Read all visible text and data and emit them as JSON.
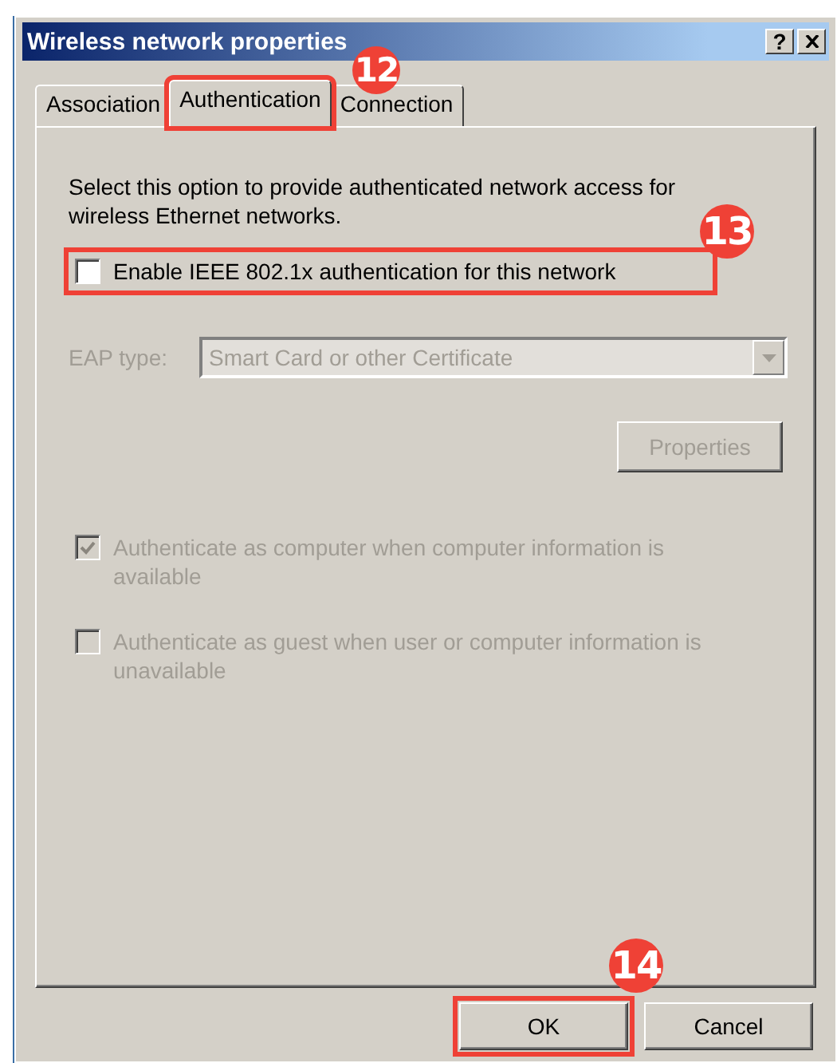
{
  "window": {
    "title": "Wireless network properties",
    "help_button": "?"
  },
  "tabs": [
    {
      "label": "Association",
      "selected": false,
      "highlighted": false
    },
    {
      "label": "Authentication",
      "selected": true,
      "highlighted": true,
      "badge": "12"
    },
    {
      "label": "Connection",
      "selected": false,
      "highlighted": false
    }
  ],
  "description": "Select this option to provide authenticated network access for wireless Ethernet networks.",
  "enable_option": {
    "label": "Enable IEEE 802.1x authentication for this network",
    "checked": false,
    "disabled": false,
    "highlighted": true,
    "badge": "13"
  },
  "eap_type": {
    "label": "EAP type:",
    "value": "Smart Card or other Certificate",
    "disabled": true
  },
  "properties_button": {
    "label": "Properties",
    "disabled": true
  },
  "auth_options": [
    {
      "label": "Authenticate as computer when computer information is available",
      "checked": true,
      "disabled": true,
      "highlighted": false
    },
    {
      "label": "Authenticate as guest when user or computer information is unavailable",
      "checked": false,
      "disabled": true,
      "highlighted": false
    }
  ],
  "buttons": [
    {
      "label": "OK",
      "highlighted": true,
      "badge": "14"
    },
    {
      "label": "Cancel",
      "highlighted": false
    }
  ]
}
